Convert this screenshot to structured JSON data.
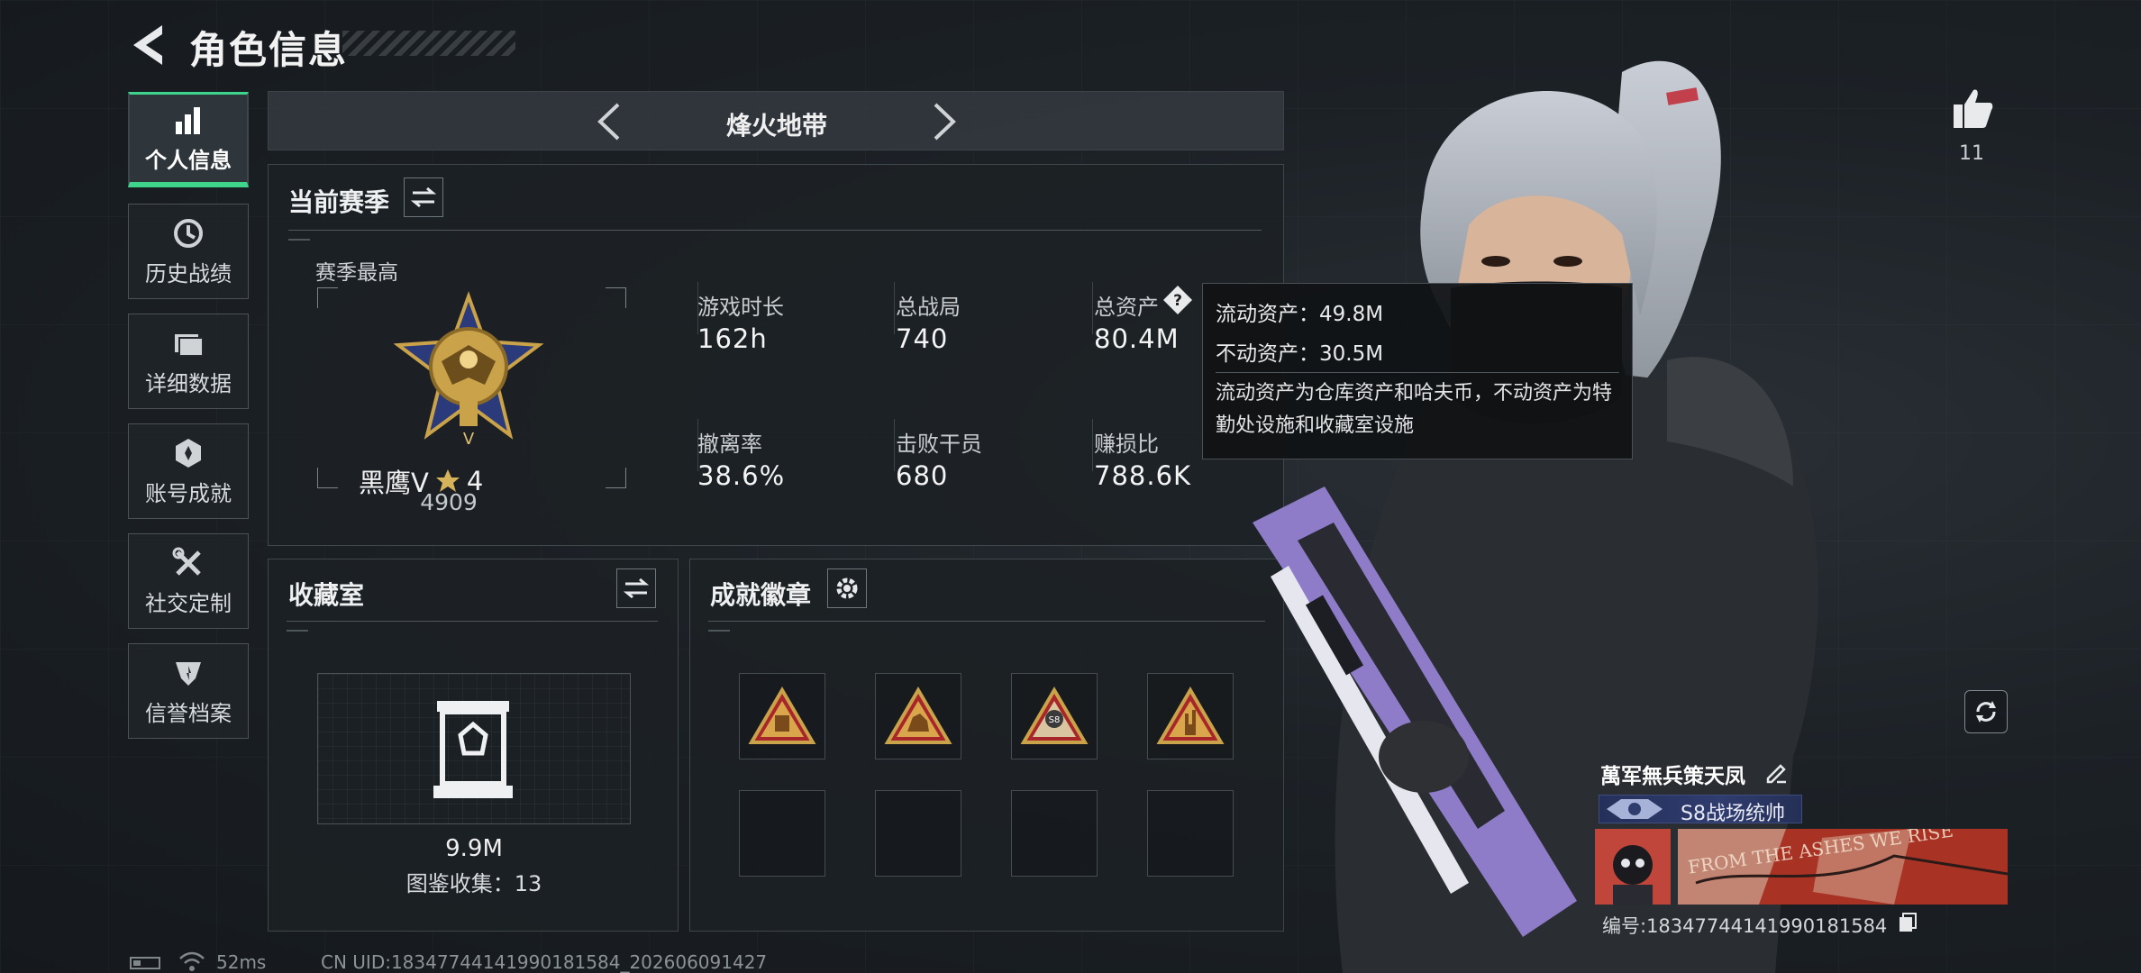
{
  "header": {
    "title": "角色信息"
  },
  "sidebar": {
    "items": [
      {
        "label": "个人信息",
        "icon": "bar-chart-icon",
        "active": true
      },
      {
        "label": "历史战绩",
        "icon": "clock-history-icon",
        "active": false
      },
      {
        "label": "详细数据",
        "icon": "folder-icon",
        "active": false
      },
      {
        "label": "账号成就",
        "icon": "medal-icon",
        "active": false
      },
      {
        "label": "社交定制",
        "icon": "tools-icon",
        "active": false
      },
      {
        "label": "信誉档案",
        "icon": "shield-star-icon",
        "active": false
      }
    ]
  },
  "mode": {
    "title": "烽火地带"
  },
  "season": {
    "title": "当前赛季",
    "best_label": "赛季最高",
    "rank_name": "黑鹰V",
    "rank_stars": "4",
    "rank_score": "4909",
    "stats": [
      {
        "label": "游戏时长",
        "value": "162h"
      },
      {
        "label": "总战局",
        "value": "740"
      },
      {
        "label": "总资产",
        "value": "80.4M"
      },
      {
        "label": "撤离率",
        "value": "38.6%"
      },
      {
        "label": "击败干员",
        "value": "680"
      },
      {
        "label": "赚损比",
        "value": "788.6K"
      }
    ]
  },
  "tooltip": {
    "liquid": "流动资产：49.8M",
    "fixed": "不动资产：30.5M",
    "desc": "流动资产为仓库资产和哈夫币，不动资产为特勤处设施和收藏室设施"
  },
  "collection": {
    "title": "收藏室",
    "value": "9.9M",
    "count": "图鉴收集：13"
  },
  "badges": {
    "title": "成就徽章"
  },
  "social": {
    "likes": "11"
  },
  "profile": {
    "name": "萬军無兵策天凤",
    "title_badge": "S8战场统帅",
    "banner_text": "FROM THE ASHES WE RISE",
    "uid": "编号:183477441419901815​84"
  },
  "status": {
    "ping": "52ms",
    "cn_uid": "CN UID:1834774414199018​1584_202606091427"
  },
  "colors": {
    "accent": "#3fd48b",
    "gold": "#c9a24a",
    "purple": "#8f7cc9"
  }
}
